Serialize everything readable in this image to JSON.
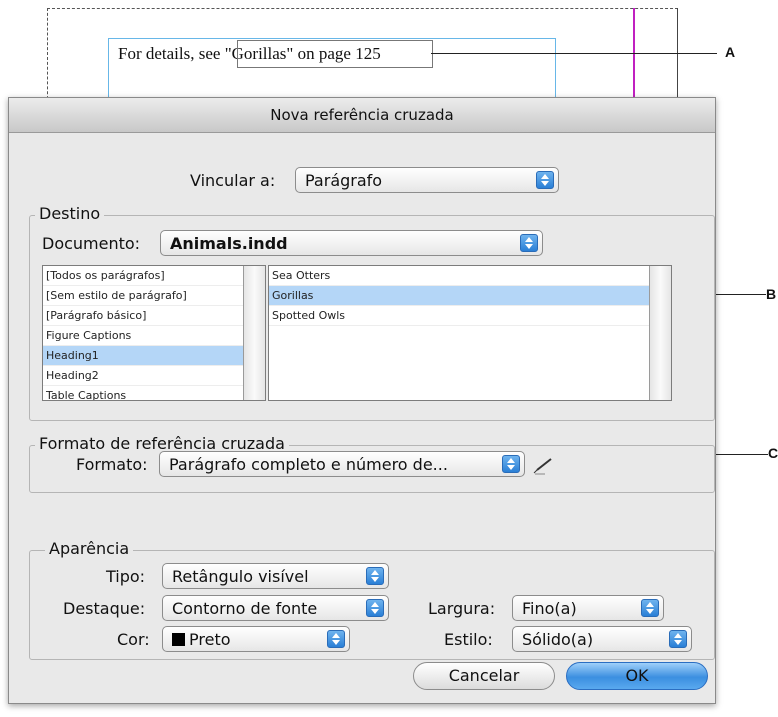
{
  "document": {
    "text_before": "For details, see ",
    "xref_text": "\"Gorillas\" on page 125"
  },
  "callouts": [
    "A",
    "B",
    "C"
  ],
  "dialog": {
    "title": "Nova referência cruzada",
    "link_to_label": "Vincular a:",
    "link_to_value": "Parágrafo",
    "destination": {
      "title": "Destino",
      "document_label": "Documento:",
      "document_value": "Animals.indd",
      "styles": [
        "[Todos os parágrafos]",
        "[Sem estilo de parágrafo]",
        "[Parágrafo básico]",
        "Figure Captions",
        "Heading1",
        "Heading2",
        "Table Captions"
      ],
      "selected_style": "Heading1",
      "paragraphs": [
        "Sea Otters",
        "Gorillas",
        "Spotted Owls"
      ],
      "selected_paragraph": "Gorillas"
    },
    "format_section": {
      "title": "Formato de referência cruzada",
      "format_label": "Formato:",
      "format_value": "Parágrafo completo e número de...",
      "edit_icon": "pencil-icon"
    },
    "appearance": {
      "title": "Aparência",
      "type_label": "Tipo:",
      "type_value": "Retângulo visível",
      "highlight_label": "Destaque:",
      "highlight_value": "Contorno de fonte",
      "color_label": "Cor:",
      "color_value": "Preto",
      "color_swatch": "#000000",
      "width_label": "Largura:",
      "width_value": "Fino(a)",
      "style_label": "Estilo:",
      "style_value": "Sólido(a)"
    },
    "buttons": {
      "cancel": "Cancelar",
      "ok": "OK"
    }
  },
  "colors": {
    "accent": "#3b8fe0",
    "selection": "#b4d6f7",
    "frame_guide": "#67b7e8",
    "margin_guide": "#c020c0"
  }
}
